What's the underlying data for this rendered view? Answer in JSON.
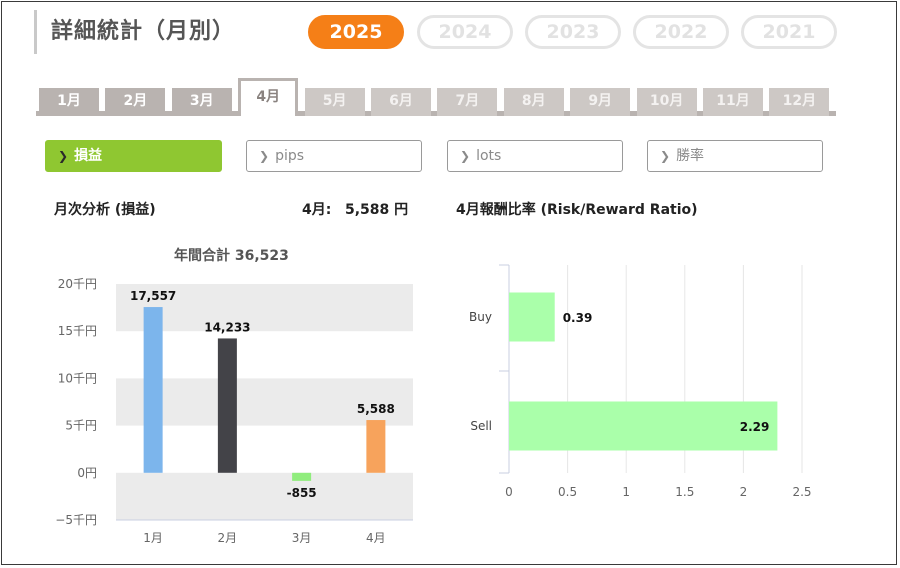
{
  "page_title": "詳細統計（月別）",
  "years": [
    {
      "label": "2025",
      "active": true
    },
    {
      "label": "2024",
      "active": false
    },
    {
      "label": "2023",
      "active": false
    },
    {
      "label": "2022",
      "active": false
    },
    {
      "label": "2021",
      "active": false
    }
  ],
  "months": [
    {
      "label": "1月",
      "state": "past"
    },
    {
      "label": "2月",
      "state": "past"
    },
    {
      "label": "3月",
      "state": "past"
    },
    {
      "label": "4月",
      "state": "active"
    },
    {
      "label": "5月",
      "state": "future"
    },
    {
      "label": "6月",
      "state": "future"
    },
    {
      "label": "7月",
      "state": "future"
    },
    {
      "label": "8月",
      "state": "future"
    },
    {
      "label": "9月",
      "state": "future"
    },
    {
      "label": "10月",
      "state": "future"
    },
    {
      "label": "11月",
      "state": "future"
    },
    {
      "label": "12月",
      "state": "future"
    }
  ],
  "metrics": [
    {
      "label": "損益",
      "active": true
    },
    {
      "label": "pips",
      "active": false
    },
    {
      "label": "lots",
      "active": false
    },
    {
      "label": "勝率",
      "active": false
    }
  ],
  "monthly_section": {
    "title": "月次分析 (損益)",
    "current_label": "4月:",
    "current_value": "5,588 円"
  },
  "ratio_section": {
    "title": "4月報酬比率 (Risk/Reward Ratio)"
  },
  "chart_data": [
    {
      "type": "bar",
      "title": "年間合計 36,523",
      "categories": [
        "1月",
        "2月",
        "3月",
        "4月"
      ],
      "values": [
        17557,
        14233,
        -855,
        5588
      ],
      "value_labels": [
        "17,557",
        "14,233",
        "-855",
        "5,588"
      ],
      "bar_colors": [
        "#7cb5ec",
        "#434348",
        "#90ed7d",
        "#f7a35c"
      ],
      "ylim": [
        -5000,
        20000
      ],
      "yticks": [
        {
          "value": 20000,
          "label": "20千円"
        },
        {
          "value": 15000,
          "label": "15千円"
        },
        {
          "value": 10000,
          "label": "10千円"
        },
        {
          "value": 5000,
          "label": "5千円"
        },
        {
          "value": 0,
          "label": "0円"
        },
        {
          "value": -5000,
          "label": "−5千円"
        }
      ],
      "grid": "alternating bands"
    },
    {
      "type": "bar",
      "orientation": "horizontal",
      "categories": [
        "Buy",
        "Sell"
      ],
      "values": [
        0.39,
        2.29
      ],
      "value_labels": [
        "0.39",
        "2.29"
      ],
      "bar_color": "#aaffaa",
      "xlim": [
        0,
        2.5
      ],
      "xticks": [
        "0",
        "0.5",
        "1",
        "1.5",
        "2",
        "2.5"
      ],
      "grid": "vertical"
    }
  ]
}
